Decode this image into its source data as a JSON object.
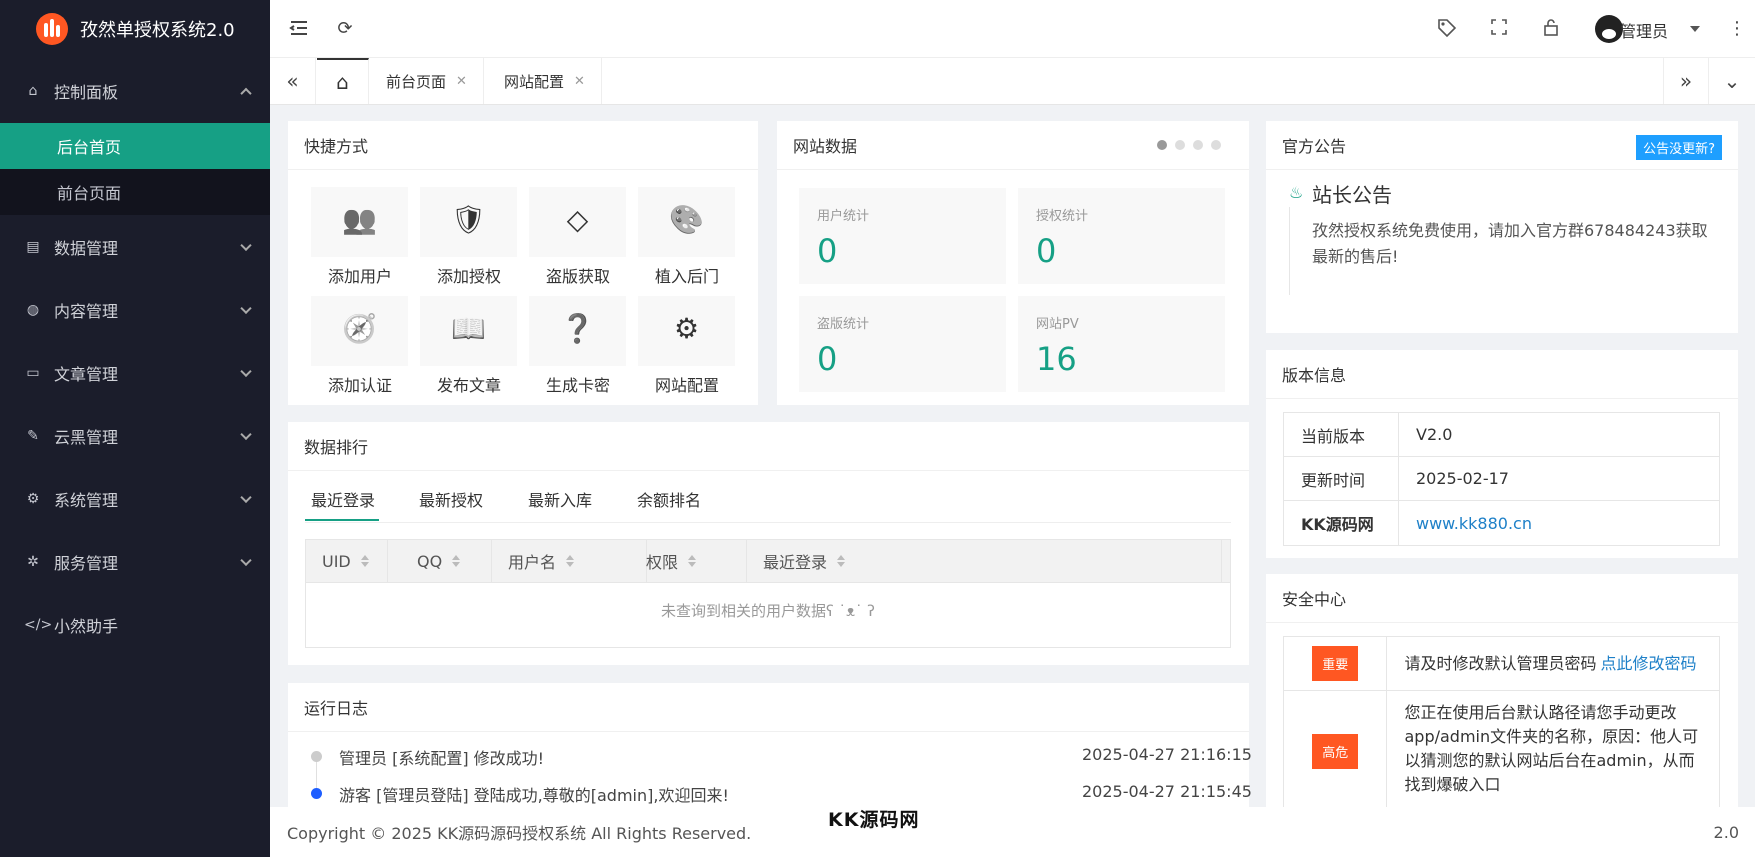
{
  "app": {
    "title": "孜然单授权系统2.0"
  },
  "sidebar": {
    "items": [
      {
        "label": "控制面板",
        "icon": "home-icon"
      },
      {
        "label": "数据管理",
        "icon": "document-icon"
      },
      {
        "label": "内容管理",
        "icon": "globe-icon"
      },
      {
        "label": "文章管理",
        "icon": "book-icon"
      },
      {
        "label": "云黑管理",
        "icon": "brush-icon"
      },
      {
        "label": "系统管理",
        "icon": "gear-icon"
      },
      {
        "label": "服务管理",
        "icon": "settings-icon"
      },
      {
        "label": "小然助手",
        "icon": "code-icon"
      }
    ],
    "sub_items": [
      {
        "label": "后台首页",
        "active": true
      },
      {
        "label": "前台页面",
        "active": false
      }
    ]
  },
  "header": {
    "user": "管理员"
  },
  "tabs": [
    {
      "label": "前台页面"
    },
    {
      "label": "网站配置"
    }
  ],
  "shortcuts": {
    "title": "快捷方式",
    "items": [
      {
        "label": "添加用户",
        "icon": "users-icon"
      },
      {
        "label": "添加授权",
        "icon": "shield-check-icon"
      },
      {
        "label": "盗版获取",
        "icon": "diamond-icon"
      },
      {
        "label": "植入后门",
        "icon": "palette-icon"
      },
      {
        "label": "添加认证",
        "icon": "compass-icon"
      },
      {
        "label": "发布文章",
        "icon": "open-book-icon"
      },
      {
        "label": "生成卡密",
        "icon": "question-edit-icon"
      },
      {
        "label": "网站配置",
        "icon": "gear-icon"
      }
    ]
  },
  "site_data": {
    "title": "网站数据",
    "stats": [
      {
        "label": "用户统计",
        "value": "0"
      },
      {
        "label": "授权统计",
        "value": "0"
      },
      {
        "label": "盗版统计",
        "value": "0"
      },
      {
        "label": "网站PV",
        "value": "16"
      }
    ]
  },
  "ranking": {
    "title": "数据排行",
    "tabs": [
      "最近登录",
      "最新授权",
      "最新入库",
      "余额排名"
    ],
    "columns": [
      "UID",
      "QQ",
      "用户名",
      "权限",
      "最近登录"
    ],
    "empty": "未查询到相关的用户数据ʕ ˙ᴥ˙ ʔ"
  },
  "logs": {
    "title": "运行日志",
    "items": [
      {
        "text": "管理员 [系统配置] 修改成功!",
        "time": "2025-04-27 21:16:15"
      },
      {
        "text": "游客 [管理员登陆] 登陆成功,尊敬的[admin],欢迎回来!",
        "time": "2025-04-27 21:15:45"
      }
    ]
  },
  "notice": {
    "title": "官方公告",
    "button": "公告没更新?",
    "heading": "站长公告",
    "body": "孜然授权系统免费使用，请加入官方群678484243获取最新的售后!"
  },
  "version": {
    "title": "版本信息",
    "rows": [
      {
        "key": "当前版本",
        "value": "V2.0"
      },
      {
        "key": "更新时间",
        "value": "2025-02-17"
      },
      {
        "key": "KK源码网",
        "value": "www.kk880.cn"
      }
    ]
  },
  "security": {
    "title": "安全中心",
    "rows": [
      {
        "badge": "重要",
        "text": "请及时修改默认管理员密码 ",
        "link": "点此修改密码"
      },
      {
        "badge": "高危",
        "text": "您正在使用后台默认路径请您手动更改app/admin文件夹的名称，原因：他人可以猜测您的默认网站后台在admin，从而找到爆破入口",
        "link": ""
      }
    ]
  },
  "footer": {
    "copyright": "Copyright © 2025 KK源码源码授权系统 All Rights Reserved.",
    "watermark": "KK源码网",
    "version": "2.0"
  },
  "colors": {
    "accent": "#16a085",
    "sidebar": "#1b1d2b",
    "danger": "#ff5722",
    "link": "#1e9fff"
  }
}
